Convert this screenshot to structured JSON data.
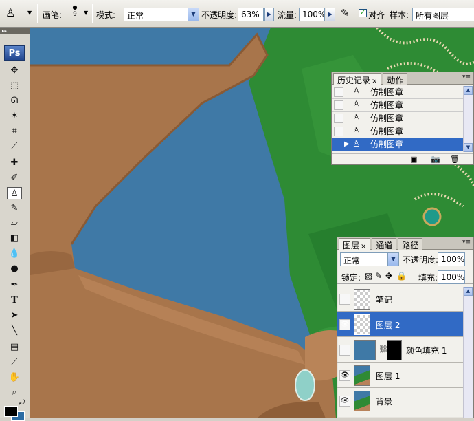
{
  "options_bar": {
    "brush_label": "画笔:",
    "brush_size": "9",
    "mode_label": "模式:",
    "mode_value": "正常",
    "opacity_label": "不透明度:",
    "opacity_value": "63%",
    "flow_label": "流量:",
    "flow_value": "100%",
    "aligned_label": "对齐",
    "sample_label": "样本:",
    "sample_value": "所有图层"
  },
  "toolbox": {
    "logo": "Ps",
    "active_tool": "clone-stamp-tool",
    "colors": {
      "foreground": "#000000",
      "background": "#2b6ba3"
    }
  },
  "history_panel": {
    "tabs": [
      "历史记录",
      "动作"
    ],
    "tab_close": "×",
    "items": [
      {
        "label": "仿制图章"
      },
      {
        "label": "仿制图章"
      },
      {
        "label": "仿制图章"
      },
      {
        "label": "仿制图章"
      },
      {
        "label": "仿制图章",
        "selected": true
      }
    ]
  },
  "layers_panel": {
    "tabs": [
      "图层",
      "通道",
      "路径"
    ],
    "tab_close": "×",
    "blend_mode": "正常",
    "opacity_label": "不透明度:",
    "opacity_value": "100%",
    "lock_label": "锁定:",
    "fill_label": "填充:",
    "fill_value": "100%",
    "layers": [
      {
        "name": "笔记",
        "visible": false,
        "thumb": "transparent"
      },
      {
        "name": "图层 2",
        "visible": true,
        "thumb": "transparent",
        "selected": true
      },
      {
        "name": "颜色填充 1",
        "visible": false,
        "thumb": "fill",
        "fill_color": "#3f79a6"
      },
      {
        "name": "图层 1",
        "visible": true,
        "thumb": "photo"
      },
      {
        "name": "背景",
        "visible": true,
        "thumb": "photo"
      }
    ]
  },
  "canvas": {
    "background_color": "#3f79a6",
    "dress_color": "#2e8b34",
    "skin_color": "#b07a50"
  }
}
